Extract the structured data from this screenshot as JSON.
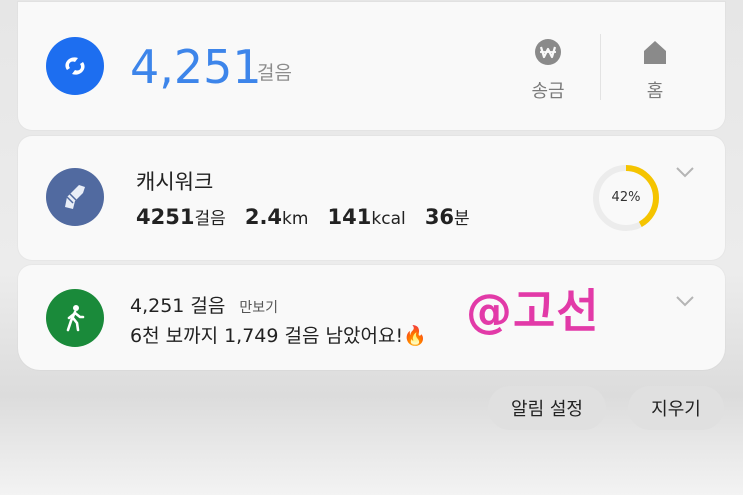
{
  "pay_widget": {
    "steps": "4,251",
    "steps_unit": "걸음",
    "actions": [
      {
        "label": "송금",
        "icon": "won-coin-icon"
      },
      {
        "label": "홈",
        "icon": "home-icon"
      }
    ]
  },
  "cashwalk": {
    "title": "캐시워크",
    "stats": [
      {
        "value": "4251",
        "unit": "걸음"
      },
      {
        "value": "2.4",
        "unit": "km"
      },
      {
        "value": "141",
        "unit": "kcal"
      },
      {
        "value": "36",
        "unit": "분"
      }
    ],
    "progress_label": "42%",
    "progress_value": 0.42
  },
  "pedometer": {
    "steps_text": "4,251 걸음",
    "app_name": "만보기",
    "message": "6천 보까지 1,749 걸음 남았어요!🔥"
  },
  "watermark": "@고선",
  "buttons": {
    "alarm_settings": "알림 설정",
    "clear": "지우기"
  },
  "colors": {
    "pay_blue": "#1d6ef0",
    "steps_blue": "#3d85ea",
    "shoe_badge": "#516aa0",
    "ring_yellow": "#f5c400",
    "walk_green": "#1a8a3a",
    "watermark_pink": "#e23aa8"
  }
}
